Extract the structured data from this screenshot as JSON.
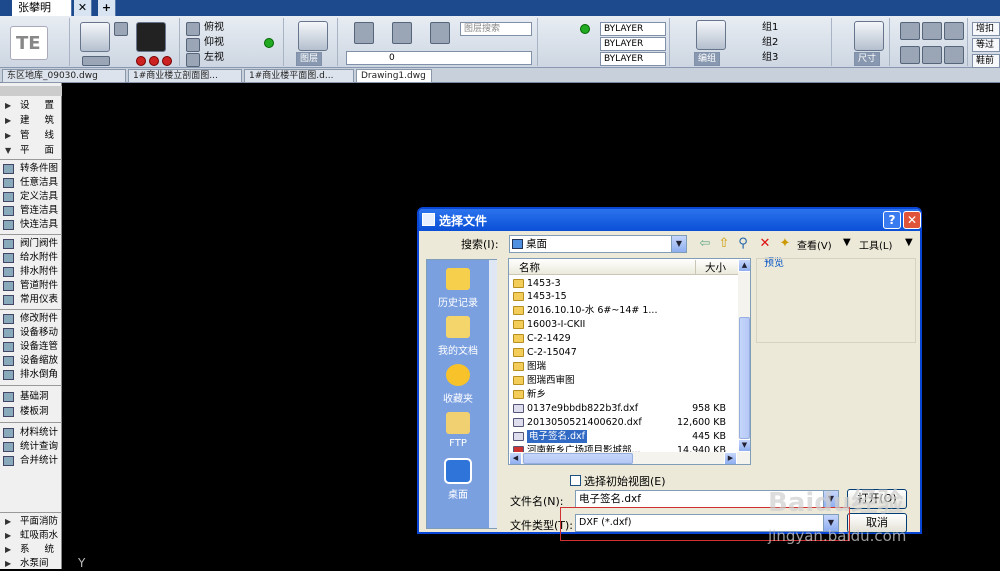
{
  "app_tabs": {
    "user_tab": "张攀明",
    "close": "✕",
    "add": "+"
  },
  "ribbon": {
    "view_buttons": [
      "俯视",
      "仰视",
      "左视"
    ],
    "layer_label": "图层",
    "layer_search": "图层搜索",
    "layer_current": "0",
    "bylayer_1": "BYLAYER",
    "bylayer_2": "BYLAYER",
    "bylayer_3": "BYLAYER",
    "edit_label": "编组",
    "groups": [
      "组1",
      "组2",
      "组3"
    ],
    "size_label": "尺寸",
    "right_buttons": [
      "增扣",
      "等过",
      "鞋前"
    ]
  },
  "doc_tabs": [
    {
      "label": "东区地库_09030.dwg",
      "active": false
    },
    {
      "label": "1#商业楼立剖面图...",
      "active": false
    },
    {
      "label": "1#商业楼平面图.d...",
      "active": false
    },
    {
      "label": "Drawing1.dwg",
      "active": true
    }
  ],
  "left_panel": {
    "sections_top": [
      "设 置",
      "建 筑",
      "管 线",
      "平 面"
    ],
    "items": [
      "转条件图",
      "任意洁具",
      "定义洁具",
      "管连洁具",
      "快连洁具",
      "阀门阀件",
      "给水附件",
      "排水附件",
      "管道附件",
      "常用仪表",
      "修改附件",
      "设备移动",
      "设备连管",
      "设备缩放",
      "排水倒角",
      "基础洞",
      "楼板洞",
      "材料统计",
      "统计查询",
      "合并统计"
    ],
    "sections_bottom": [
      "平面消防",
      "虹吸雨水",
      "系 统",
      "水泵间"
    ]
  },
  "dialog": {
    "title": "选择文件",
    "lookin_label": "搜索(I):",
    "lookin_value": "桌面",
    "view_label": "查看(V)",
    "tools_label": "工具(L)",
    "preview_label": "预览",
    "places": [
      "历史记录",
      "我的文档",
      "收藏夹",
      "FTP",
      "桌面"
    ],
    "columns": {
      "name": "名称",
      "size": "大小"
    },
    "files": [
      {
        "name": "1453-3",
        "type": "folder",
        "size": ""
      },
      {
        "name": "1453-15",
        "type": "folder",
        "size": ""
      },
      {
        "name": "2016.10.10-水 6#~14# 1...",
        "type": "folder",
        "size": ""
      },
      {
        "name": "16003-I-CKII",
        "type": "folder",
        "size": ""
      },
      {
        "name": "C-2-1429",
        "type": "folder",
        "size": ""
      },
      {
        "name": "C-2-15047",
        "type": "folder",
        "size": ""
      },
      {
        "name": "图瑞",
        "type": "folder",
        "size": ""
      },
      {
        "name": "图瑞西审图",
        "type": "folder",
        "size": ""
      },
      {
        "name": "新乡",
        "type": "folder",
        "size": ""
      },
      {
        "name": "0137e9bbdb822b3f.dxf",
        "type": "file",
        "size": "958 KB"
      },
      {
        "name": "2013050521400620.dxf",
        "type": "file",
        "size": "12,600 KB"
      },
      {
        "name": "电子签名.dxf",
        "type": "file",
        "size": "445 KB",
        "selected": true
      },
      {
        "name": "河南新乡广场项目影城部...",
        "type": "file",
        "size": "14,940 KB"
      }
    ],
    "initial_view_label": "选择初始视图(E)",
    "filename_label": "文件名(N):",
    "filename_value": "电子签名.dxf",
    "filetype_label": "文件类型(T):",
    "filetype_value": "DXF (*.dxf)",
    "open_button": "打开(O)",
    "cancel_button": "取消"
  },
  "canvas": {
    "axis_label": "Y"
  },
  "watermark": {
    "line1": "Baidu经验",
    "line2": "jingyan.baidu.com"
  }
}
